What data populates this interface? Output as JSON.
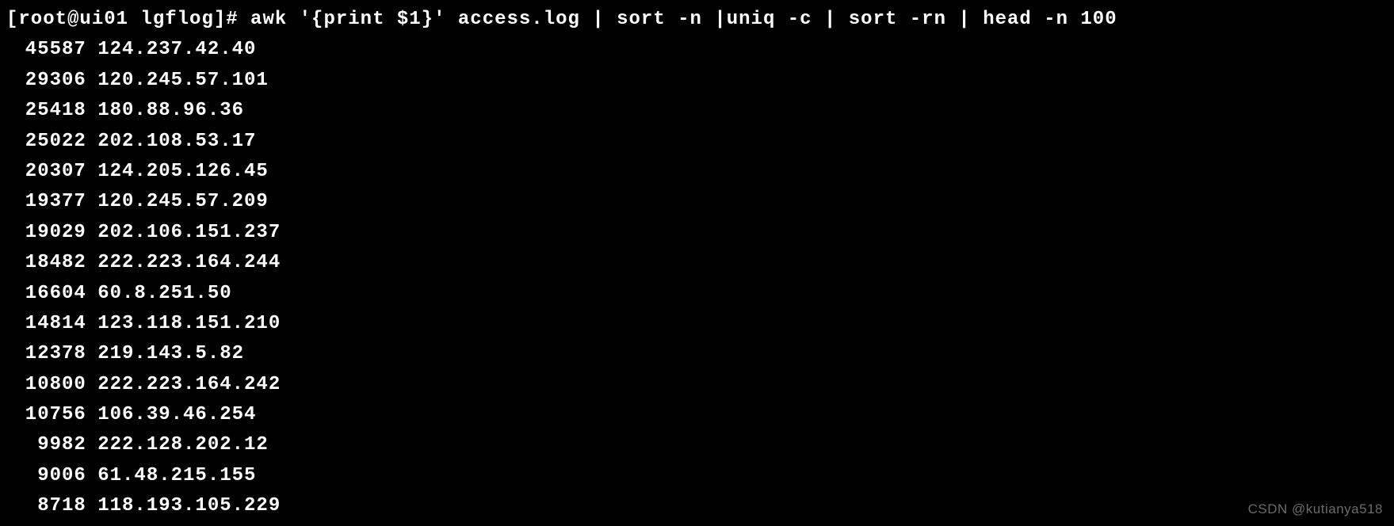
{
  "terminal": {
    "prompt": "[root@ui01 lgflog]# ",
    "command": "awk '{print $1}' access.log | sort -n |uniq -c | sort -rn | head -n 100",
    "output": [
      {
        "count": "45587",
        "ip": "124.237.42.40"
      },
      {
        "count": "29306",
        "ip": "120.245.57.101"
      },
      {
        "count": "25418",
        "ip": "180.88.96.36"
      },
      {
        "count": "25022",
        "ip": "202.108.53.17"
      },
      {
        "count": "20307",
        "ip": "124.205.126.45"
      },
      {
        "count": "19377",
        "ip": "120.245.57.209"
      },
      {
        "count": "19029",
        "ip": "202.106.151.237"
      },
      {
        "count": "18482",
        "ip": "222.223.164.244"
      },
      {
        "count": "16604",
        "ip": "60.8.251.50"
      },
      {
        "count": "14814",
        "ip": "123.118.151.210"
      },
      {
        "count": "12378",
        "ip": "219.143.5.82"
      },
      {
        "count": "10800",
        "ip": "222.223.164.242"
      },
      {
        "count": "10756",
        "ip": "106.39.46.254"
      },
      {
        "count": "9982",
        "ip": "222.128.202.12"
      },
      {
        "count": "9006",
        "ip": "61.48.215.155"
      },
      {
        "count": "8718",
        "ip": "118.193.105.229"
      }
    ]
  },
  "watermark": "CSDN @kutianya518"
}
